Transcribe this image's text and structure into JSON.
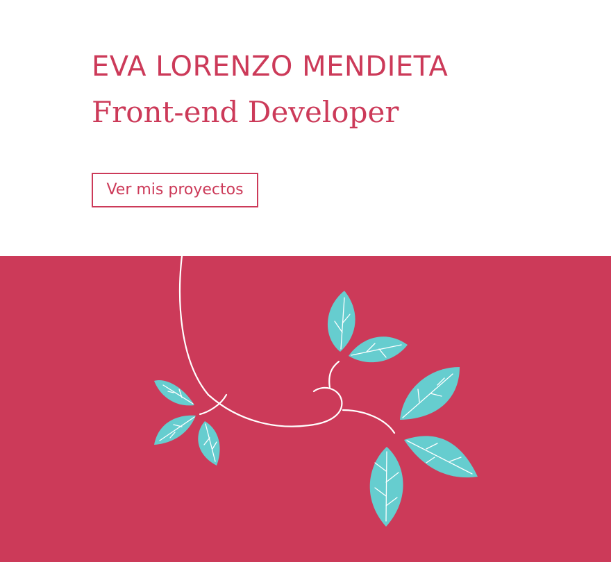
{
  "hero": {
    "name": "EVA LORENZO MENDIETA",
    "role": "Front-end Developer",
    "cta_label": "Ver mis proyectos"
  },
  "colors": {
    "accent": "#cc3a59",
    "background": "#ffffff",
    "leaf": "#66cdcf",
    "line": "#ffffff"
  },
  "illustration": {
    "icon": "vine-with-leaves-icon"
  }
}
